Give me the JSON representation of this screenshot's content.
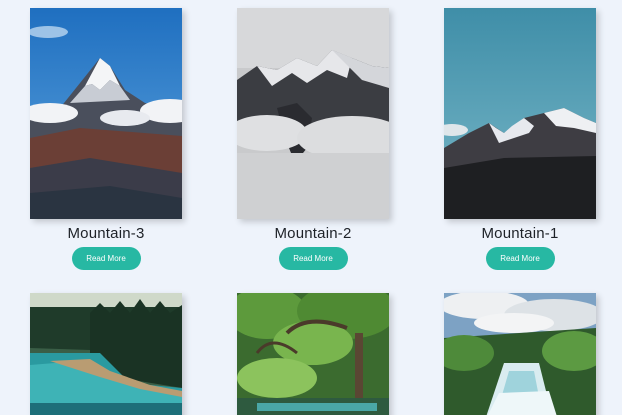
{
  "cards_top": [
    {
      "title": "Mountain-3",
      "button": "Read More",
      "image_subject": "snow-capped peak above clouds"
    },
    {
      "title": "Mountain-2",
      "button": "Read More",
      "image_subject": "grey mountain ridge with mist"
    },
    {
      "title": "Mountain-1",
      "button": "Read More",
      "image_subject": "dark mountain range under teal sky"
    }
  ],
  "cards_bottom": [
    {
      "image_subject": "lake with pine forest"
    },
    {
      "image_subject": "green forest with river"
    },
    {
      "image_subject": "waterfall rapids under cloudy sky"
    }
  ],
  "colors": {
    "background": "#eef3fb",
    "button": "#27b8a3",
    "button_text": "#ffffff",
    "title_text": "#1e2228"
  }
}
